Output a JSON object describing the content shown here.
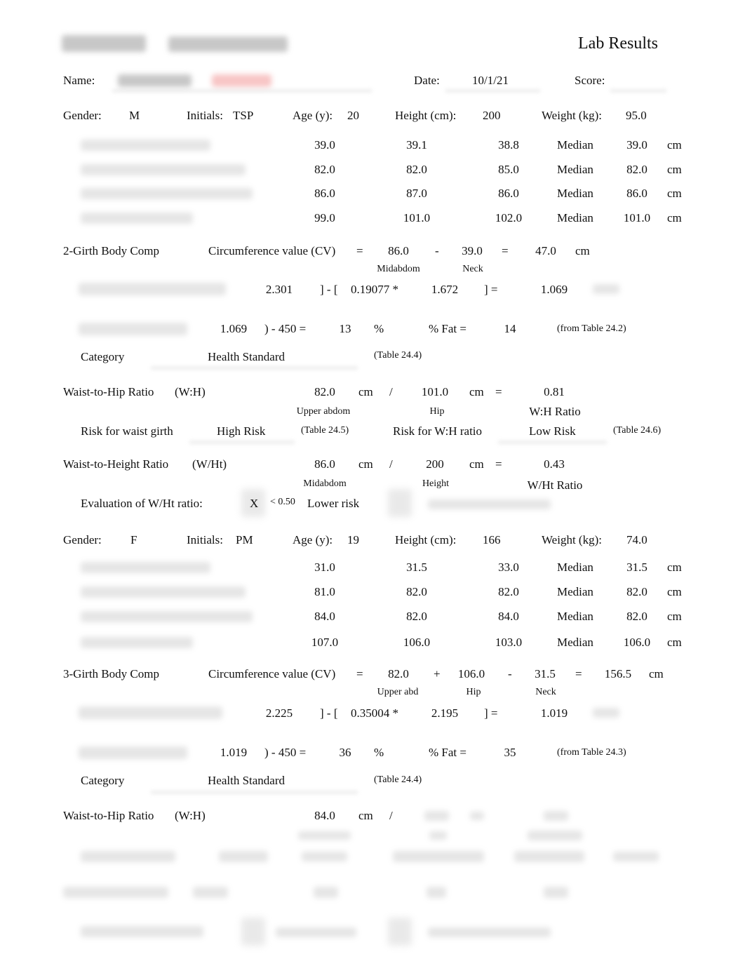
{
  "header": {
    "title": "Lab Results",
    "name_label": "Name:",
    "date_label": "Date:",
    "date_value": "10/1/21",
    "score_label": "Score:"
  },
  "labels": {
    "gender": "Gender:",
    "initials": "Initials:",
    "age": "Age (y):",
    "height": "Height (cm):",
    "weight": "Weight (kg):",
    "median": "Median",
    "cm": "cm",
    "cv": "Circumference value (CV)",
    "eq": "=",
    "minus": "-",
    "plus": "+",
    "slash": "/",
    "pct": "%",
    "pct_fat": "% Fat =",
    "category": "Category",
    "category_value": "Health Standard",
    "table_24_4": "(Table 24.4)",
    "whr": "Waist-to-Hip Ratio",
    "whr_abbr": "(W:H)",
    "whtr": "Waist-to-Height Ratio",
    "whtr_abbr": "(W/Ht)",
    "upper_abdom": "Upper abdom",
    "upper_abd": "Upper abd",
    "midabdom": "Midabdom",
    "hip": "Hip",
    "neck": "Neck",
    "height_sub": "Height",
    "wh_ratio": "W:H Ratio",
    "wht_ratio": "W/Ht Ratio",
    "risk_waist": "Risk for waist girth",
    "risk_wh": "Risk for W:H ratio",
    "table_24_5": "(Table 24.5)",
    "table_24_6": "(Table 24.6)",
    "eval_wht": "Evaluation of W/Ht ratio:",
    "lt_050": "< 0.50",
    "lower_risk": "Lower risk",
    "bracket_close_minus": "]  -  [",
    "bracket_close_eq": "]  =",
    "paren_minus_450": ")  -  450  ="
  },
  "subject1": {
    "gender": "M",
    "initials": "TSP",
    "age": "20",
    "height": "200",
    "weight": "95.0",
    "girths": [
      {
        "t1": "39.0",
        "t2": "39.1",
        "t3": "38.8",
        "median": "39.0"
      },
      {
        "t1": "82.0",
        "t2": "82.0",
        "t3": "85.0",
        "median": "82.0"
      },
      {
        "t1": "86.0",
        "t2": "87.0",
        "t3": "86.0",
        "median": "86.0"
      },
      {
        "t1": "99.0",
        "t2": "101.0",
        "t3": "102.0",
        "median": "101.0"
      }
    ],
    "bodycomp_title": "2-Girth Body Comp",
    "cv_a": "86.0",
    "cv_b": "39.0",
    "cv_result": "47.0",
    "db_term1": "2.301",
    "db_coef": "0.19077 *",
    "db_term2": "1.672",
    "db_result": "1.069",
    "siri_db": "1.069",
    "siri_pct": "13",
    "table_pct": "14",
    "table_ref": "(from Table 24.2)",
    "whr_waist": "82.0",
    "whr_hip": "101.0",
    "whr_result": "0.81",
    "risk_waist": "High Risk",
    "risk_wh": "Low Risk",
    "whtr_waist": "86.0",
    "whtr_height": "200",
    "whtr_result": "0.43",
    "eval_mark": "X"
  },
  "subject2": {
    "gender": "F",
    "initials": "PM",
    "age": "19",
    "height": "166",
    "weight": "74.0",
    "girths": [
      {
        "t1": "31.0",
        "t2": "31.5",
        "t3": "33.0",
        "median": "31.5"
      },
      {
        "t1": "81.0",
        "t2": "82.0",
        "t3": "82.0",
        "median": "82.0"
      },
      {
        "t1": "84.0",
        "t2": "82.0",
        "t3": "84.0",
        "median": "82.0"
      },
      {
        "t1": "107.0",
        "t2": "106.0",
        "t3": "103.0",
        "median": "106.0"
      }
    ],
    "bodycomp_title": "3-Girth Body Comp",
    "cv_a": "82.0",
    "cv_b": "106.0",
    "cv_c": "31.5",
    "cv_result": "156.5",
    "db_term1": "2.225",
    "db_coef": "0.35004 *",
    "db_term2": "2.195",
    "db_result": "1.019",
    "siri_db": "1.019",
    "siri_pct": "36",
    "table_pct": "35",
    "table_ref": "(from Table 24.3)",
    "whr_waist": "84.0"
  }
}
